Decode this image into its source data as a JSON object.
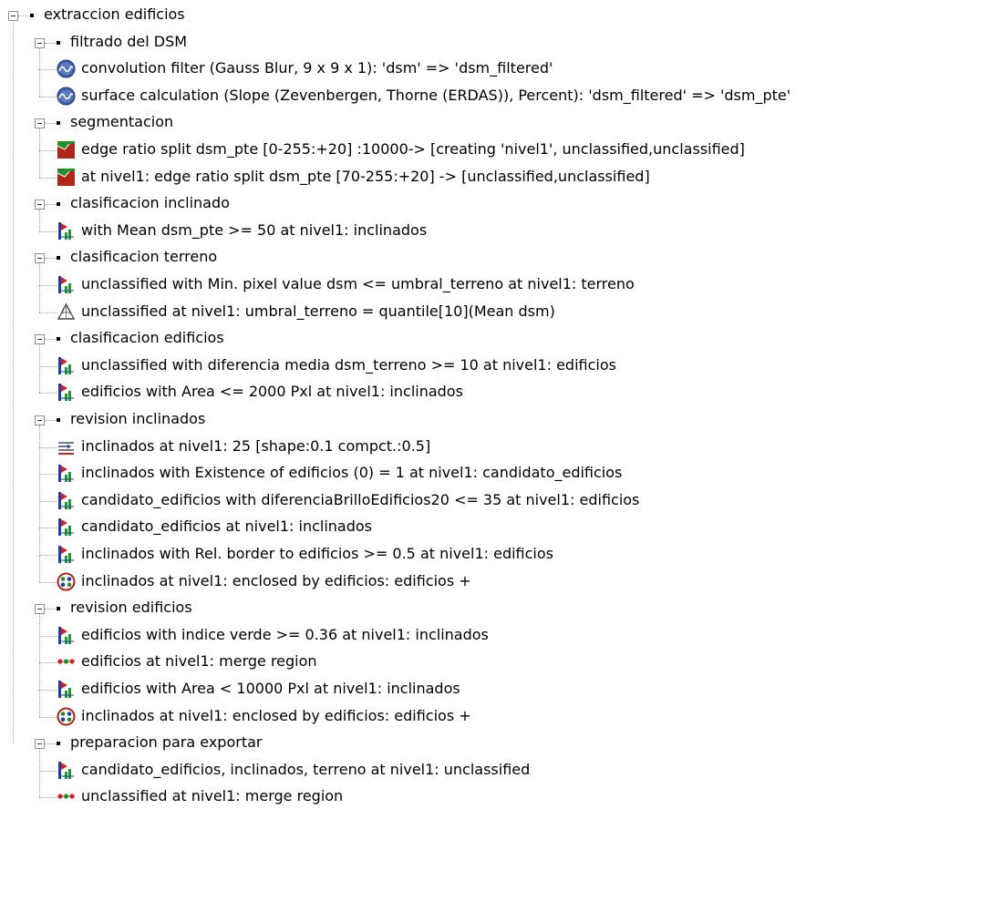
{
  "nodes": [
    {
      "level": 0,
      "type": "group",
      "label": "extraccion edificios"
    },
    {
      "level": 1,
      "type": "group",
      "label": "filtrado del DSM"
    },
    {
      "level": 2,
      "type": "process",
      "icon": "convolution-filter-icon",
      "label": "convolution filter (Gauss Blur, 9 x 9 x 1): 'dsm' => 'dsm_filtered'"
    },
    {
      "level": 2,
      "type": "process",
      "icon": "convolution-filter-icon",
      "label": "surface calculation (Slope (Zevenbergen, Thorne (ERDAS)), Percent): 'dsm_filtered' => 'dsm_pte'"
    },
    {
      "level": 1,
      "type": "group",
      "label": "segmentacion"
    },
    {
      "level": 2,
      "type": "process",
      "icon": "segmentation-icon",
      "label": "edge ratio split dsm_pte [0-255:+20] :10000-> [creating 'nivel1', unclassified,unclassified]"
    },
    {
      "level": 2,
      "type": "process",
      "icon": "segmentation-icon",
      "label": "at  nivel1: edge ratio split dsm_pte [70-255:+20] -> [unclassified,unclassified]"
    },
    {
      "level": 1,
      "type": "group",
      "label": "clasificacion inclinado"
    },
    {
      "level": 2,
      "type": "process",
      "icon": "assign-class-icon",
      "label": "with Mean dsm_pte >= 50  at  nivel1: inclinados"
    },
    {
      "level": 1,
      "type": "group",
      "label": "clasificacion terreno"
    },
    {
      "level": 2,
      "type": "process",
      "icon": "assign-class-icon",
      "label": "unclassified with Min. pixel value dsm <= umbral_terreno at  nivel1: terreno"
    },
    {
      "level": 2,
      "type": "process",
      "icon": "compute-statistics-icon",
      "label": "unclassified at  nivel1: umbral_terreno = quantile[10](Mean dsm)"
    },
    {
      "level": 1,
      "type": "group",
      "label": "clasificacion edificios"
    },
    {
      "level": 2,
      "type": "process",
      "icon": "assign-class-icon",
      "label": "unclassified with diferencia media dsm_terreno >= 10  at  nivel1: edificios"
    },
    {
      "level": 2,
      "type": "process",
      "icon": "assign-class-icon",
      "label": "edificios with Area <= 2000 Pxl at  nivel1: inclinados"
    },
    {
      "level": 1,
      "type": "group",
      "label": "revision inclinados"
    },
    {
      "level": 2,
      "type": "process",
      "icon": "multiresolution-segmentation-icon",
      "label": "inclinados at  nivel1: 25 [shape:0.1 compct.:0.5]"
    },
    {
      "level": 2,
      "type": "process",
      "icon": "assign-class-icon",
      "label": "inclinados with Existence of edificios (0) = 1  at  nivel1: candidato_edificios"
    },
    {
      "level": 2,
      "type": "process",
      "icon": "assign-class-icon",
      "label": "candidato_edificios with diferenciaBrilloEdificios20 <= 35  at  nivel1: edificios"
    },
    {
      "level": 2,
      "type": "process",
      "icon": "assign-class-icon",
      "label": "candidato_edificios at  nivel1: inclinados"
    },
    {
      "level": 2,
      "type": "process",
      "icon": "assign-class-icon",
      "label": "inclinados with Rel. border to edificios >= 0.5  at  nivel1: edificios"
    },
    {
      "level": 2,
      "type": "process",
      "icon": "find-enclosed-icon",
      "label": "inclinados at  nivel1: enclosed by edificios: edificios +"
    },
    {
      "level": 1,
      "type": "group",
      "label": "revision edificios"
    },
    {
      "level": 2,
      "type": "process",
      "icon": "assign-class-icon",
      "label": "edificios with indice verde >= 0.36  at  nivel1: inclinados"
    },
    {
      "level": 2,
      "type": "process",
      "icon": "merge-region-icon",
      "label": "edificios at  nivel1: merge region"
    },
    {
      "level": 2,
      "type": "process",
      "icon": "assign-class-icon",
      "label": "edificios with Area < 10000 Pxl at  nivel1: inclinados"
    },
    {
      "level": 2,
      "type": "process",
      "icon": "find-enclosed-icon",
      "label": "inclinados at  nivel1: enclosed by edificios: edificios +"
    },
    {
      "level": 1,
      "type": "group",
      "label": "preparacion para exportar"
    },
    {
      "level": 2,
      "type": "process",
      "icon": "assign-class-icon",
      "label": "candidato_edificios, inclinados, terreno at  nivel1: unclassified"
    },
    {
      "level": 2,
      "type": "process",
      "icon": "merge-region-icon",
      "label": "unclassified at  nivel1: merge region"
    }
  ]
}
